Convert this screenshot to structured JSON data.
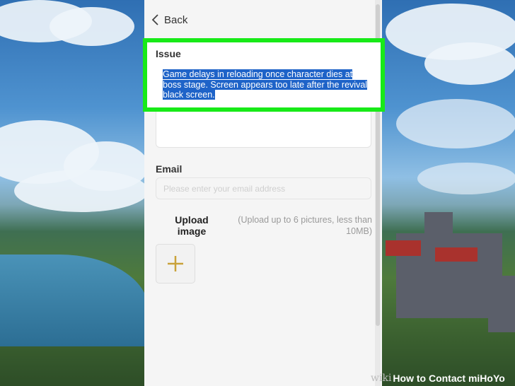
{
  "header": {
    "back_label": "Back"
  },
  "issue": {
    "label": "Issue",
    "text": "Game delays in reloading once character dies at boss stage. Screen appears too late after the revival black screen."
  },
  "email": {
    "label": "Email",
    "placeholder": "Please enter your email address"
  },
  "upload": {
    "label": "Upload image",
    "hint": "(Upload up to 6 pictures, less than 10MB)"
  },
  "watermark": {
    "wiki": "wiki",
    "title": "How to Contact miHoYo"
  },
  "colors": {
    "highlight": "#18ea18",
    "selection": "#1e63c8",
    "plus": "#c9a23a"
  },
  "icons": {
    "back": "chevron-left-icon",
    "add": "plus-icon"
  }
}
